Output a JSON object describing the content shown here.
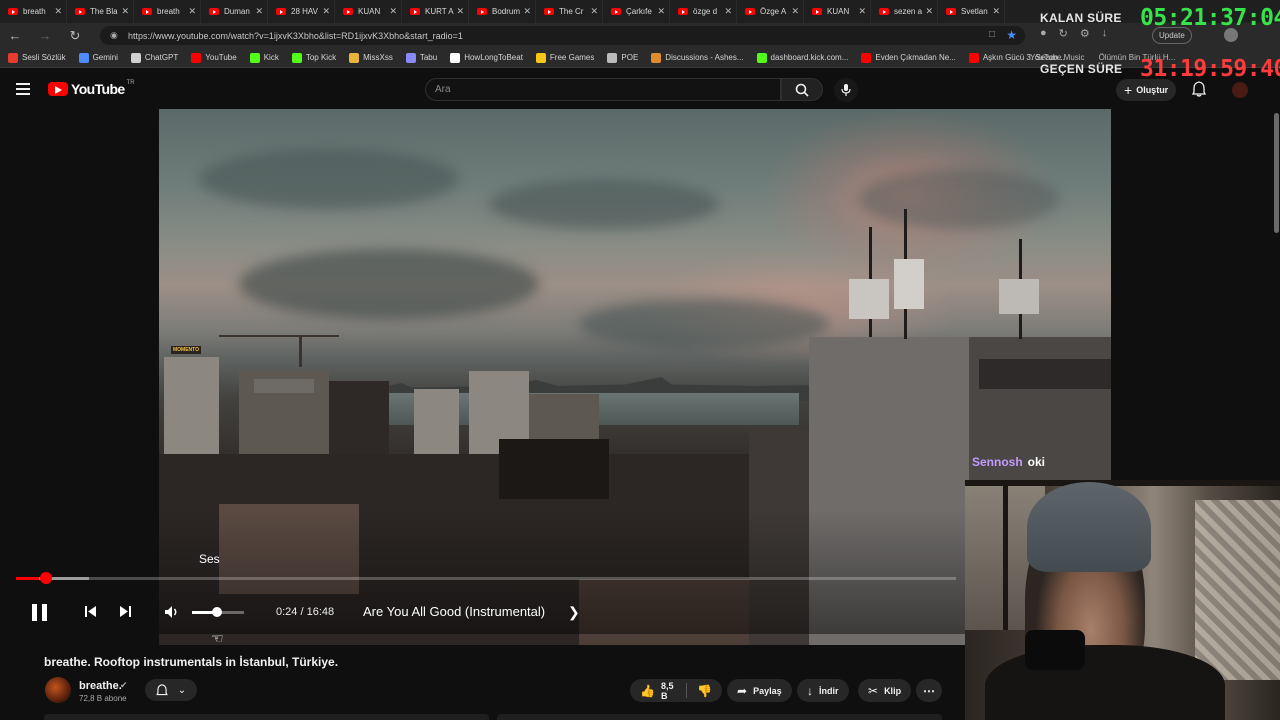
{
  "browser": {
    "tabs": [
      {
        "label": "breath"
      },
      {
        "label": "The Bla"
      },
      {
        "label": "breath"
      },
      {
        "label": "Duman"
      },
      {
        "label": "28 HAV"
      },
      {
        "label": "KUAN"
      },
      {
        "label": "KURT A"
      },
      {
        "label": "Bodrum"
      },
      {
        "label": "The Cr"
      },
      {
        "label": "Çarkıfe"
      },
      {
        "label": "özge d"
      },
      {
        "label": "Özge A"
      },
      {
        "label": "KUAN"
      },
      {
        "label": "sezen a"
      },
      {
        "label": "Svetlan"
      }
    ],
    "url": "https://www.youtube.com/watch?v=1ijxvK3Xbho&list=RD1ijxvK3Xbho&start_radio=1",
    "update_label": "Update",
    "bookmarks": [
      {
        "label": "Sesli Sözlük",
        "color": "#e63b2e"
      },
      {
        "label": "Gemini",
        "color": "#4e8cff"
      },
      {
        "label": "ChatGPT",
        "color": "#d0d0d0"
      },
      {
        "label": "YouTube",
        "color": "#ff0000"
      },
      {
        "label": "Kick",
        "color": "#53fc18"
      },
      {
        "label": "Top Kick",
        "color": "#53fc18"
      },
      {
        "label": "MissXss",
        "color": "#e8b53a"
      },
      {
        "label": "Tabu",
        "color": "#8a8aff"
      },
      {
        "label": "HowLongToBeat",
        "color": "#ffffff"
      },
      {
        "label": "Free Games",
        "color": "#f5c518"
      },
      {
        "label": "POE",
        "color": "#bbbbbb"
      },
      {
        "label": "Discussions - Ashes...",
        "color": "#e08b2c"
      },
      {
        "label": "dashboard.kick.com...",
        "color": "#53fc18"
      },
      {
        "label": "Evden Çıkmadan Ne...",
        "color": "#ff0000"
      },
      {
        "label": "Aşkın Gücü 3. Sezon...",
        "color": "#ff0000"
      }
    ],
    "bookmarks_overflow": [
      {
        "label": "YouTube Music"
      },
      {
        "label": "Ölümün Bin Türlü H..."
      }
    ]
  },
  "timers": {
    "remaining_label": "KALAN SÜRE",
    "remaining_value": "05:21:37:04",
    "elapsed_label": "GEÇEN SÜRE",
    "elapsed_value": "31:19:59:40"
  },
  "youtube": {
    "logo_text": "YouTube",
    "country_code": "TR",
    "search_placeholder": "Ara",
    "create_label": "Oluştur"
  },
  "player": {
    "volume_tooltip": "Ses",
    "time": "0:24 / 16:48",
    "chapter": "Are You All Good (Instrumental)",
    "progress_fraction": 0.024,
    "buffered_fraction": 0.078,
    "volume_fraction": 0.48,
    "watermark": "MOMENTO"
  },
  "video": {
    "title": "breathe. Rooftop instrumentals in İstanbul, Türkiye.",
    "channel_name": "breathe.",
    "subscribers": "72,8 B abone",
    "likes": "8,5 B",
    "share_label": "Paylaş",
    "download_label": "İndir",
    "clip_label": "Klip"
  },
  "chat": {
    "user": "Sennosh",
    "message": "oki"
  }
}
